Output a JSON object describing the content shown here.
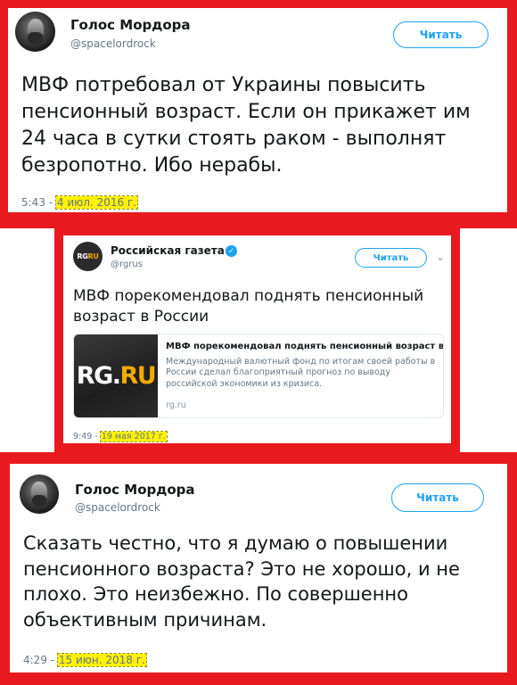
{
  "tweets": [
    {
      "author_name": "Голос Мордора",
      "author_handle": "@spacelordrock",
      "follow_label": "Читать",
      "text": "МВФ потребовал от Украины повысить пенсионный возраст. Если он прикажет им 24 часа в сутки стоять раком - выполнят безропотно. Ибо нерабы.",
      "time": "5:43 - ",
      "date": "4 июл. 2016 г."
    },
    {
      "author_name": "Российская газета",
      "author_handle": "@rgrus",
      "follow_label": "Читать",
      "logo_rg": "RG",
      "logo_ru": "RU",
      "text": "МВФ порекомендовал поднять пенсионный возраст в России",
      "link_card": {
        "thumb_rg": "RG.",
        "thumb_ru": "RU",
        "title": "МВФ порекомендовал поднять пенсионный возраст в Р...",
        "description": "Международный валютный фонд по итогам своей работы в России сделал благоприятный прогноз по выводу российской экономики из кризиса.",
        "domain": "rg.ru"
      },
      "time": "9:49 - ",
      "date": "19 мая 2017 г."
    },
    {
      "author_name": "Голос Мордора",
      "author_handle": "@spacelordrock",
      "follow_label": "Читать",
      "text": "Сказать честно, что я думаю о повышении пенсионного возраста? Это не хорошо, и не плохо. Это неизбежно. По совершенно объективным причинам.",
      "time": "4:29 - ",
      "date": "15 июн. 2018 г."
    }
  ],
  "colors": {
    "frame_red": "#e8191f",
    "twitter_blue": "#1da1f2",
    "highlight_yellow": "#fff200"
  }
}
